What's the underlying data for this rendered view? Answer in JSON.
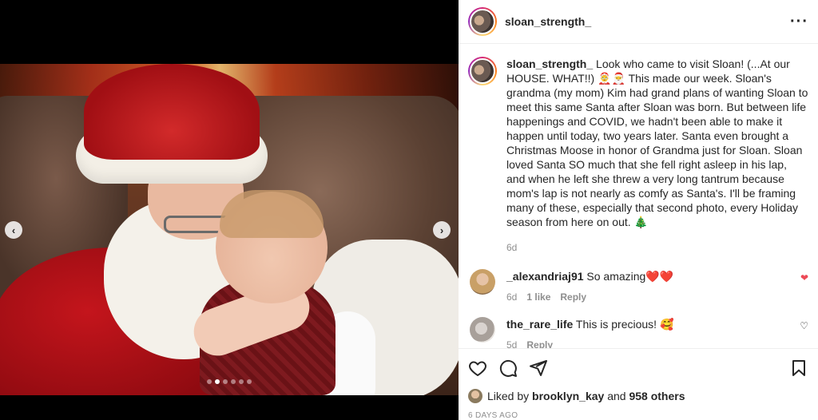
{
  "post": {
    "username": "sloan_strength_",
    "caption": "Look who came to visit Sloan! (...At our HOUSE. WHAT!!) 🤶🎅 This made our week. Sloan's grandma (my mom) Kim had grand plans of wanting Sloan to meet this same Santa after Sloan was born. But between life happenings and COVID, we hadn't been able to make it happen until today, two years later. Santa even brought a Christmas Moose in honor of Grandma just for Sloan. Sloan loved Santa SO much that she fell right asleep in his lap, and when he left she threw a very long tantrum because mom's lap is not nearly as comfy as Santa's. I'll be framing many of these, especially that second photo, every Holiday season from here on out. 🎄",
    "caption_time": "6d",
    "more_icon": "more-horizontal-icon"
  },
  "media": {
    "prev_icon": "‹",
    "next_icon": "›",
    "dots": [
      1,
      2,
      3,
      4,
      5,
      6
    ],
    "active_dot": 1
  },
  "comments": [
    {
      "username": "_alexandriaj91",
      "text": "So amazing❤️❤️",
      "time": "6d",
      "likes": "1 like",
      "reply": "Reply",
      "liked": true
    },
    {
      "username": "the_rare_life",
      "text": "This is precious! 🥰",
      "time": "5d",
      "likes": "",
      "reply": "Reply",
      "liked": false
    }
  ],
  "actions": {
    "like_icon": "heart-icon",
    "comment_icon": "comment-icon",
    "share_icon": "share-icon",
    "save_icon": "bookmark-icon"
  },
  "likes": {
    "prefix": "Liked by",
    "user": "brooklyn_kay",
    "and": "and",
    "others": "958 others"
  },
  "posted_ago": "6 DAYS AGO",
  "colors": {
    "liked_heart": "#ed4956",
    "muted_text": "#8e8e8e",
    "divider": "#efefef"
  }
}
